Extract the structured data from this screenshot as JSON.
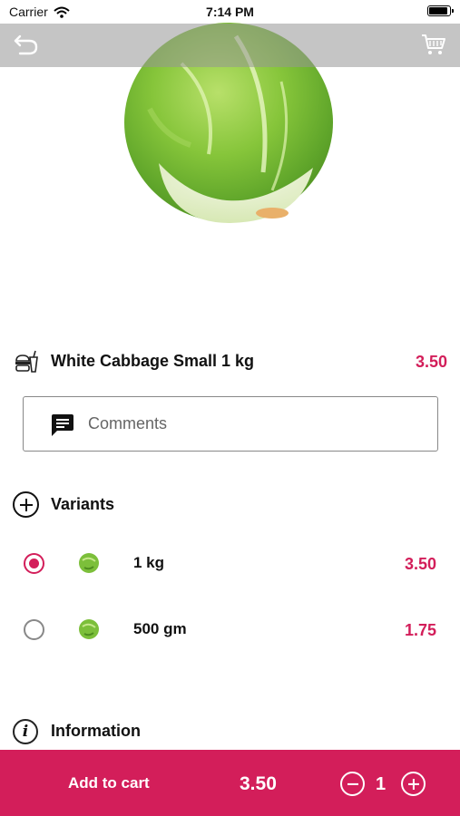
{
  "status_bar": {
    "carrier": "Carrier",
    "time": "7:14 PM"
  },
  "header": {
    "back_icon": "back-arrow-icon",
    "cart_icon": "cart-icon"
  },
  "product": {
    "name": "White Cabbage Small 1 kg",
    "price": "3.50",
    "icon": "food-icon"
  },
  "comments": {
    "placeholder": "Comments",
    "icon": "comment-icon"
  },
  "variants": {
    "label": "Variants",
    "items": [
      {
        "label": "1 kg",
        "price": "3.50",
        "selected": true
      },
      {
        "label": "500 gm",
        "price": "1.75",
        "selected": false
      }
    ]
  },
  "information": {
    "label": "Information"
  },
  "bottom_bar": {
    "add_to_cart": "Add to cart",
    "total": "3.50",
    "quantity": "1"
  },
  "colors": {
    "accent": "#d31e5a",
    "bar_gray": "#969696"
  }
}
